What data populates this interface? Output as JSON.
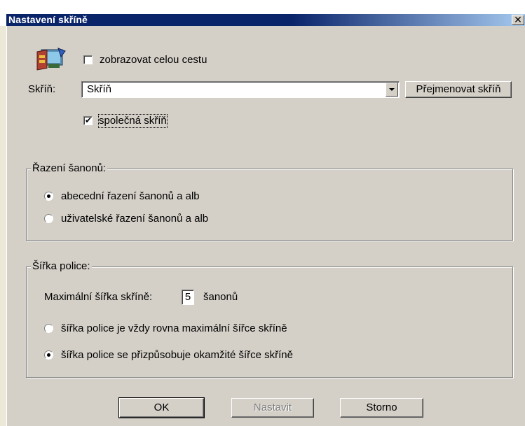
{
  "window": {
    "title": "Nastavení skříně",
    "close_glyph": "✕"
  },
  "icon": "cabinet-app-icon",
  "show_full_path": {
    "label": "zobrazovat celou cestu",
    "checked": false
  },
  "cabinet": {
    "label": "Skříň:",
    "value": "Skříň",
    "rename_button": "Přejmenovat skříň"
  },
  "shared_cabinet": {
    "label": "společná skříň",
    "checked": true
  },
  "sorting": {
    "legend": "Řazení šanonů:",
    "options": [
      {
        "label": "abecední řazení šanonů a alb",
        "selected": true
      },
      {
        "label": "uživatelské řazení šanonů a alb",
        "selected": false
      }
    ]
  },
  "shelf_width": {
    "legend": "Šířka police:",
    "max_width_label": "Maximální šířka skříně:",
    "max_width_value": "5",
    "max_width_unit": "šanonů",
    "options": [
      {
        "label": "šířka police je vždy rovna maximální šířce skříně",
        "selected": false
      },
      {
        "label": "šířka police se přizpůsobuje okamžité šířce skříně",
        "selected": true
      }
    ]
  },
  "buttons": {
    "ok": "OK",
    "apply": "Nastavit",
    "cancel": "Storno"
  },
  "colors": {
    "title_bar": "#0a246a",
    "dialog_face": "#d4d0c8"
  }
}
